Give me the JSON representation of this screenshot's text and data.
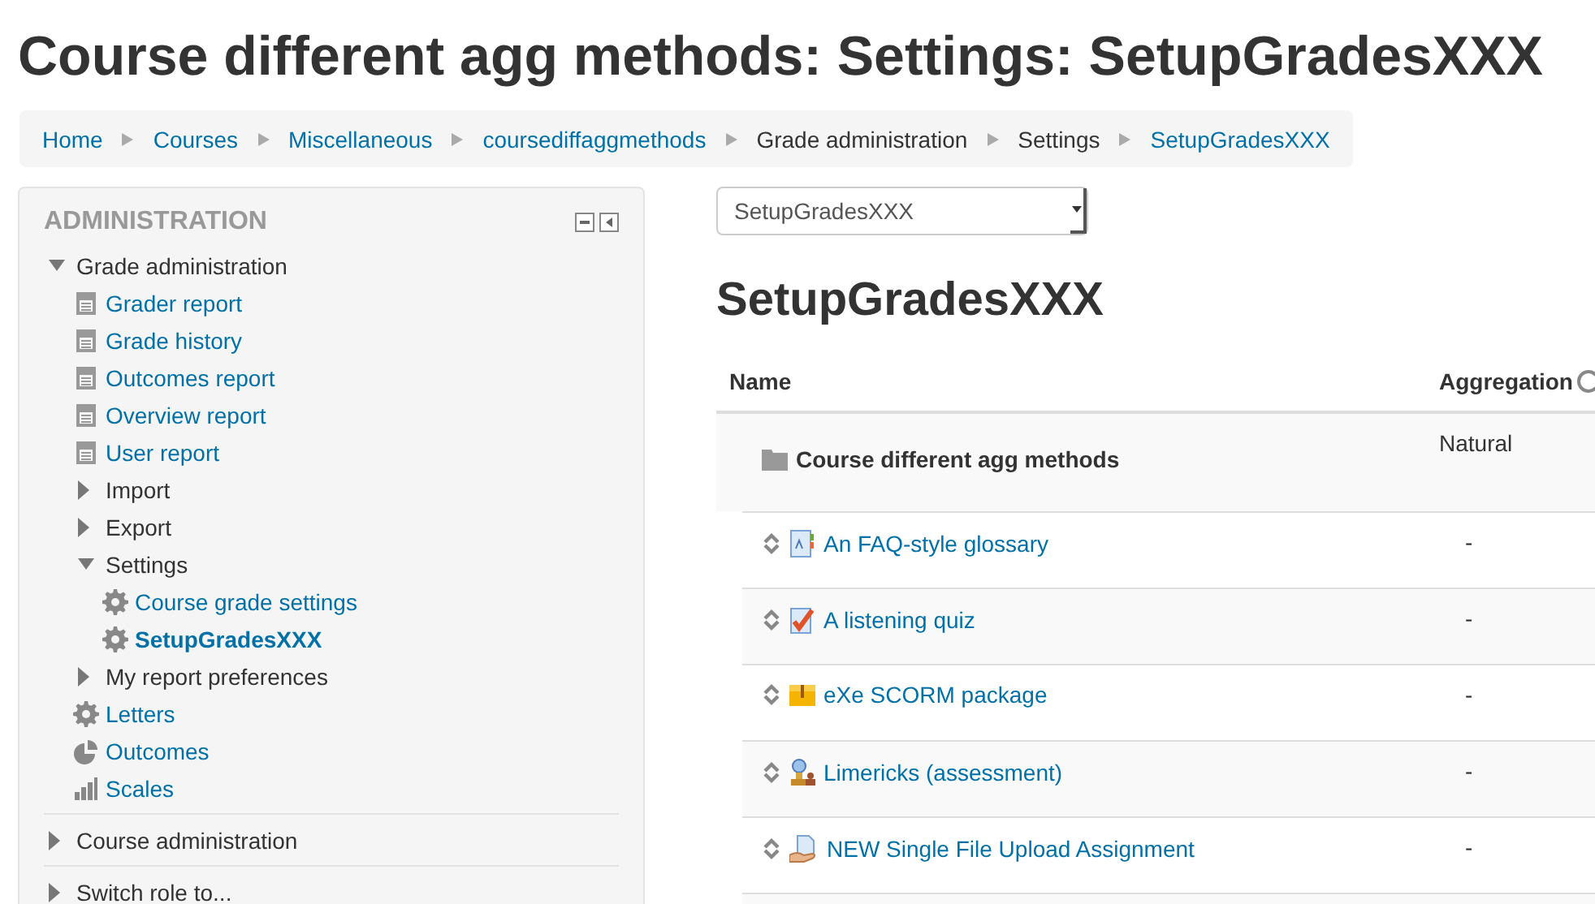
{
  "page_title": "Course different agg methods: Settings: SetupGradesXXX",
  "breadcrumb": [
    {
      "label": "Home",
      "link": true
    },
    {
      "label": "Courses",
      "link": true
    },
    {
      "label": "Miscellaneous",
      "link": true
    },
    {
      "label": "coursediffaggmethods",
      "link": true
    },
    {
      "label": "Grade administration",
      "link": false
    },
    {
      "label": "Settings",
      "link": false
    },
    {
      "label": "SetupGradesXXX",
      "link": true
    }
  ],
  "sidebar": {
    "title": "ADMINISTRATION",
    "items": [
      {
        "kind": "branch",
        "label": "Grade administration",
        "expanded": true,
        "children": [
          {
            "kind": "report",
            "label": "Grader report",
            "selected": false
          },
          {
            "kind": "report",
            "label": "Grade history",
            "selected": false
          },
          {
            "kind": "report",
            "label": "Outcomes report",
            "selected": false
          },
          {
            "kind": "report",
            "label": "Overview report",
            "selected": false
          },
          {
            "kind": "report",
            "label": "User report",
            "selected": false
          },
          {
            "kind": "branch",
            "label": "Import",
            "expanded": false
          },
          {
            "kind": "branch",
            "label": "Export",
            "expanded": false
          },
          {
            "kind": "branch",
            "label": "Settings",
            "expanded": true,
            "children": [
              {
                "kind": "gear",
                "label": "Course grade settings",
                "selected": false
              },
              {
                "kind": "gear",
                "label": "SetupGradesXXX",
                "selected": true
              }
            ]
          },
          {
            "kind": "branch",
            "label": "My report preferences",
            "expanded": false
          },
          {
            "kind": "gear",
            "label": "Letters",
            "selected": false
          },
          {
            "kind": "outcomes",
            "label": "Outcomes",
            "selected": false
          },
          {
            "kind": "scales",
            "label": "Scales",
            "selected": false
          }
        ]
      },
      {
        "kind": "branch",
        "label": "Course administration",
        "expanded": false
      },
      {
        "kind": "branch",
        "label": "Switch role to...",
        "expanded": false
      }
    ]
  },
  "selector": {
    "value": "SetupGradesXXX"
  },
  "heading": "SetupGradesXXX",
  "table": {
    "columns": [
      "Name",
      "Aggregation"
    ],
    "rows": [
      {
        "kind": "category",
        "name": "Course different agg methods",
        "aggregation": "Natural"
      },
      {
        "kind": "glossary",
        "name": "An FAQ-style glossary",
        "aggregation": "-"
      },
      {
        "kind": "quiz",
        "name": "A listening quiz",
        "aggregation": "-"
      },
      {
        "kind": "scorm",
        "name": "eXe SCORM package",
        "aggregation": "-"
      },
      {
        "kind": "workshop",
        "name": "Limericks (assessment)",
        "aggregation": "-"
      },
      {
        "kind": "assignment",
        "name": "NEW Single File Upload Assignment",
        "aggregation": "-"
      }
    ]
  }
}
